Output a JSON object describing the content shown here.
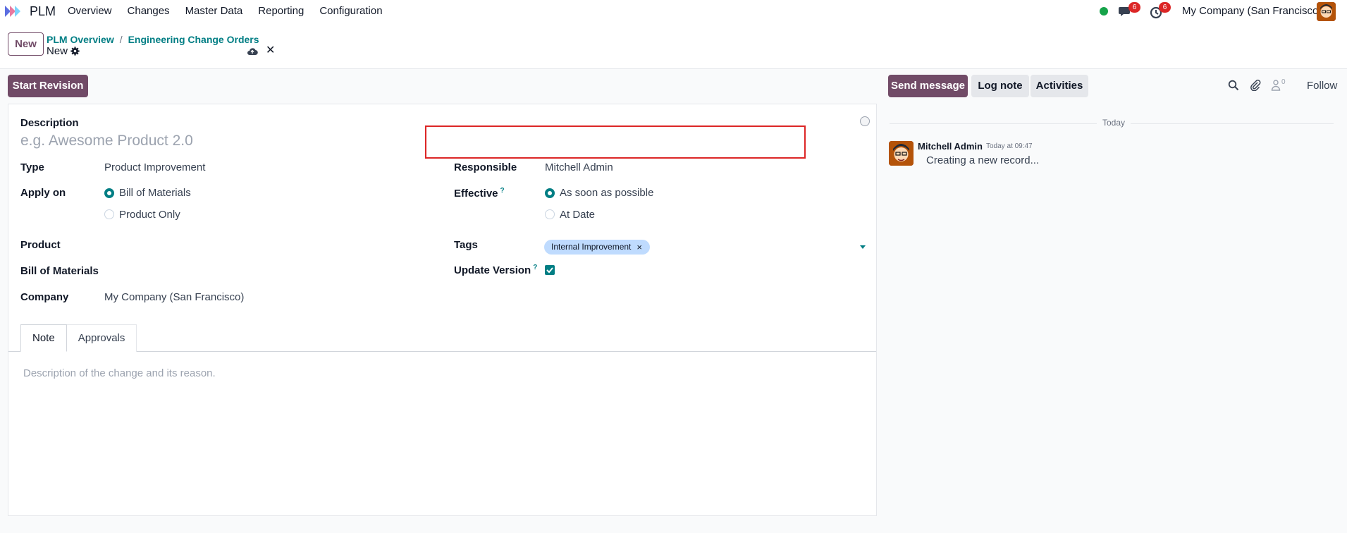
{
  "navbar": {
    "app_name": "PLM",
    "menu": [
      "Overview",
      "Changes",
      "Master Data",
      "Reporting",
      "Configuration"
    ],
    "messages_badge": "6",
    "activities_badge": "6",
    "company": "My Company (San Francisco)"
  },
  "control_panel": {
    "new_label": "New",
    "breadcrumb": [
      "PLM Overview",
      "Engineering Change Orders"
    ],
    "breadcrumb_separator": "/",
    "record_name": "New"
  },
  "statusbar": {
    "start_revision_label": "Start Revision"
  },
  "form": {
    "description_label": "Description",
    "description_placeholder": "e.g. Awesome Product 2.0",
    "type_label": "Type",
    "type_value": "Product Improvement",
    "apply_on_label": "Apply on",
    "apply_on_options": [
      "Bill of Materials",
      "Product Only"
    ],
    "apply_on_selected": "Bill of Materials",
    "product_label": "Product",
    "bom_label": "Bill of Materials",
    "company_label": "Company",
    "company_value": "My Company (San Francisco)",
    "responsible_label": "Responsible",
    "responsible_value": "Mitchell Admin",
    "effective_label": "Effective",
    "effective_help": "?",
    "effective_options": [
      "As soon as possible",
      "At Date"
    ],
    "effective_selected": "As soon as possible",
    "tags_label": "Tags",
    "tags": [
      "Internal Improvement"
    ],
    "tag_remove": "×",
    "update_version_label": "Update Version",
    "update_version_help": "?",
    "update_version_checked": true
  },
  "notebook": {
    "tabs": [
      "Note",
      "Approvals"
    ],
    "active_tab": "Note",
    "note_placeholder": "Description of the change and its reason."
  },
  "chatter": {
    "send_message_label": "Send message",
    "log_note_label": "Log note",
    "activities_label": "Activities",
    "follower_count": "0",
    "follow_label": "Follow",
    "date_separator": "Today",
    "messages": [
      {
        "author": "Mitchell Admin",
        "time": "Today at 09:47",
        "body": "Creating a new record..."
      }
    ]
  },
  "colors": {
    "brand": "#714b67",
    "accent": "#017e84",
    "highlight": "#dc2626",
    "tag_bg": "#bfdbfe"
  }
}
